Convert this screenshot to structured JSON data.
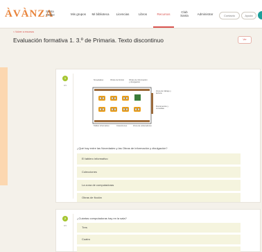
{
  "header": {
    "logo": "ÀVÀNZA",
    "logo_sub": "Santa Sadler",
    "nav": [
      {
        "label": "Mis grupos"
      },
      {
        "label": "Mi biblioteca"
      },
      {
        "label": "Licencias"
      },
      {
        "label": "Libros"
      },
      {
        "label": "Recursos",
        "active": true
      },
      {
        "label": "Club Santa"
      },
      {
        "label": "Administrar"
      }
    ],
    "contact_label": "Contacto",
    "help_label": "Ayuda"
  },
  "page": {
    "breadcrumb": "< Volver a recursos",
    "title": "Evaluación formativa 1. 3.º de Primaria. Texto discontinuo",
    "save_label": "Ver"
  },
  "questions": [
    {
      "number": "1",
      "points": "0/1",
      "plan_labels": [
        "Novedades",
        "Obras de ficción",
        "Obras de información y divulgación",
        "Zona de trabajo y lectura",
        "Documentos y consultas",
        "Tablón informativo",
        "Colecciones",
        "Zona de ordenadores"
      ],
      "prompt": "¿Qué hay entre las Novedades y las Obras de información y divulgación?",
      "options": [
        "El tablero informativo",
        "Colecciones",
        "La zona de computadoras",
        "Obras de ficción"
      ]
    },
    {
      "number": "2",
      "points": "0/1",
      "prompt": "¿Cuántas computadoras hay en la sala?",
      "options": [
        "Tres",
        "Cuatro",
        ""
      ]
    }
  ],
  "colors": {
    "accent": "#d9534f",
    "logo": "#e8833a",
    "badge": "#a5c530",
    "option_bg": "#f5f4de"
  }
}
